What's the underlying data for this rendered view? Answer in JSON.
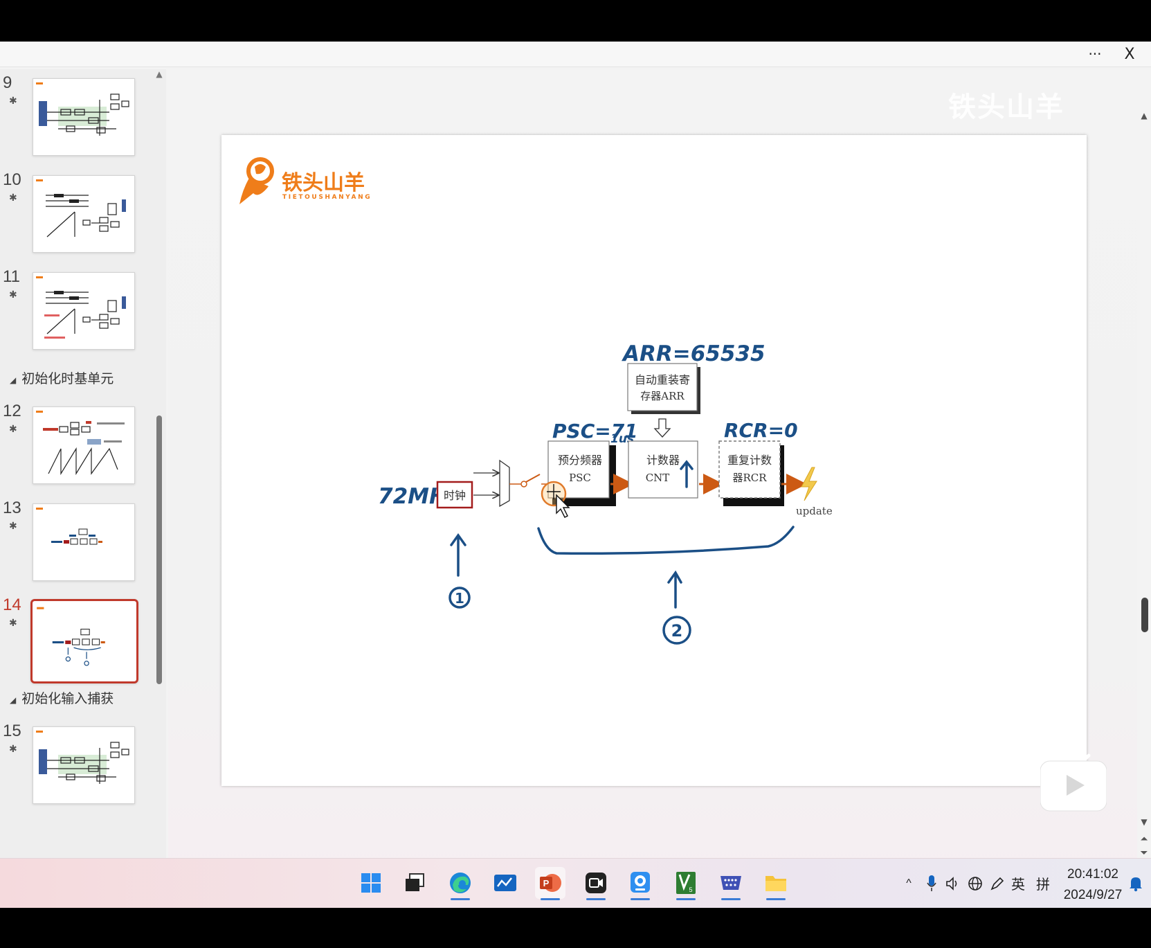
{
  "titlebar": {
    "more_label": "···",
    "close_label": "X"
  },
  "sidebar": {
    "slides": [
      {
        "number": "9"
      },
      {
        "number": "10"
      },
      {
        "number": "11"
      },
      {
        "number": "12"
      },
      {
        "number": "13"
      },
      {
        "number": "14",
        "active": true
      },
      {
        "number": "15"
      }
    ],
    "star_glyph": "✱",
    "sections": [
      "初始化时基单元",
      "初始化输入捕获"
    ]
  },
  "watermark": "铁头山羊",
  "slide": {
    "logo_cn": "铁头山羊",
    "logo_en": "TIETOUSHANYANG",
    "blocks": {
      "clock": "时钟",
      "arr_line1": "自动重装寄",
      "arr_line2": "存器ARR",
      "psc_line1": "预分频器",
      "psc_line2": "PSC",
      "cnt_line1": "计数器",
      "cnt_line2": "CNT",
      "rcr_line1": "重复计数",
      "rcr_line2": "器RCR",
      "update": "update"
    },
    "annotations": {
      "freq": "72MHz",
      "arr": "ARR=65535",
      "psc": "PSC=71",
      "us": "1us",
      "rcr": "RCR=0",
      "marker1": "1",
      "marker2": "2"
    },
    "colors": {
      "clock_border": "#a31c1c",
      "arrow": "#cc5a14",
      "ink": "#1b4f86",
      "brand": "#ef7d1a"
    }
  },
  "taskbar": {
    "apps": [
      {
        "name": "start",
        "icon": "windows-logo-icon"
      },
      {
        "name": "task-view",
        "icon": "task-view-icon"
      },
      {
        "name": "edge",
        "icon": "edge-browser-icon",
        "running": true
      },
      {
        "name": "whiteboard",
        "icon": "whiteboard-icon"
      },
      {
        "name": "powerpoint",
        "icon": "powerpoint-icon",
        "running": true,
        "active": true
      },
      {
        "name": "video-recorder",
        "icon": "video-camera-icon",
        "running": true
      },
      {
        "name": "webcam",
        "icon": "webcam-icon",
        "running": true
      },
      {
        "name": "keil",
        "icon": "keil-v5-icon",
        "running": true
      },
      {
        "name": "serial-port",
        "icon": "serial-port-icon",
        "running": true
      },
      {
        "name": "file-explorer",
        "icon": "folder-icon",
        "running": true
      }
    ],
    "tray": {
      "chevron": "^",
      "ime_lang": "英",
      "ime_mode": "拼"
    },
    "time": "20:41:02",
    "date": "2024/9/27"
  }
}
